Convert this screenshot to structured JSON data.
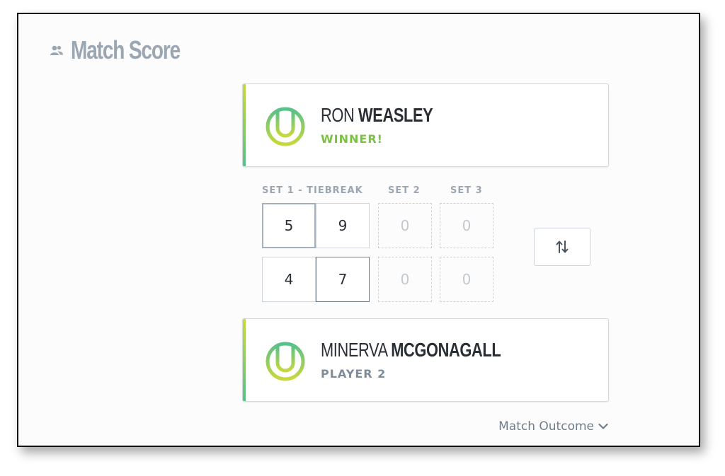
{
  "header": {
    "title": "Match Score",
    "icon": "users-icon"
  },
  "colors": {
    "winner_status": "#7cc242",
    "player_status": "#7f8c99",
    "accent_top": "#c7d93b",
    "accent_bottom": "#58c08a"
  },
  "players": [
    {
      "first_name": "RON",
      "last_name": "WEASLEY",
      "status": "WINNER!",
      "is_winner": true
    },
    {
      "first_name": "MINERVA",
      "last_name": "MCGONAGALL",
      "status": "PLAYER 2",
      "is_winner": false
    }
  ],
  "sets": {
    "labels": [
      "SET 1 - TIEBREAK",
      "SET 2",
      "SET 3"
    ],
    "player1": {
      "set1": "5",
      "tiebreak": "9",
      "set2": "0",
      "set3": "0"
    },
    "player2": {
      "set1": "4",
      "tiebreak": "7",
      "set2": "0",
      "set3": "0"
    }
  },
  "swap_button": {
    "icon": "swap-vertical-icon"
  },
  "outcome": {
    "label": "Match Outcome",
    "icon": "chevron-down-icon"
  }
}
